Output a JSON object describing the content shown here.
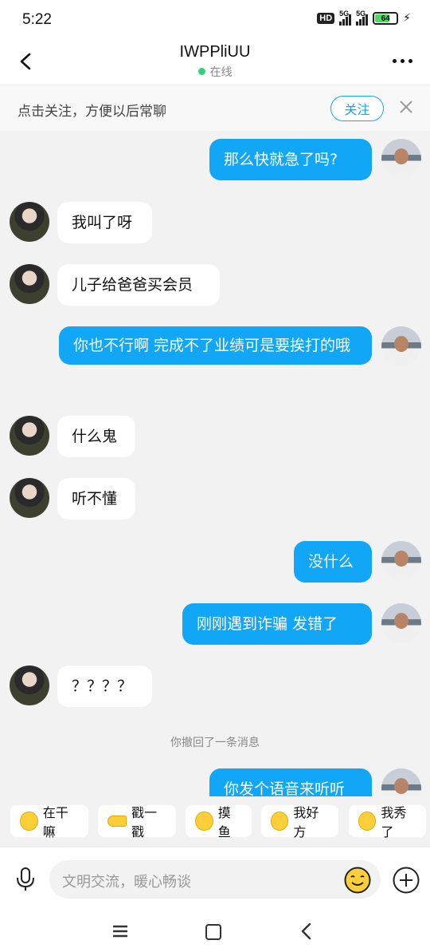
{
  "status_bar": {
    "time": "5:22",
    "hd_label": "HD",
    "network1": "5G",
    "network2": "5G",
    "battery_level": "64",
    "battery_color": "#4cd964"
  },
  "header": {
    "contact_name": "IWPPliUU",
    "presence": "在线",
    "presence_color": "#35d07f"
  },
  "follow_bar": {
    "text": "点击关注，方便以后常聊",
    "button_label": "关注",
    "accent": "#12a6f7"
  },
  "messages": [
    {
      "from": "me",
      "text": "那么快就急了吗?"
    },
    {
      "from": "them",
      "text": "我叫了呀"
    },
    {
      "from": "them",
      "text": "儿子给爸爸买会员"
    },
    {
      "from": "me",
      "text": "你也不行啊  完成不了业绩可是要挨打的哦"
    },
    {
      "from": "them",
      "text": "什么鬼"
    },
    {
      "from": "them",
      "text": "听不懂"
    },
    {
      "from": "me",
      "text": "没什么"
    },
    {
      "from": "me",
      "text": "刚刚遇到诈骗  发错了"
    },
    {
      "from": "them",
      "text": "？？？？"
    },
    {
      "from": "system",
      "text": "你撤回了一条消息"
    },
    {
      "from": "me",
      "text": "你发个语音来听听"
    }
  ],
  "quick_replies": [
    {
      "label": "在干嘛",
      "icon": "emoji-icon"
    },
    {
      "label": "戳一戳",
      "icon": "poke-hand-icon"
    },
    {
      "label": "摸鱼",
      "icon": "emoji-icon"
    },
    {
      "label": "我好方",
      "icon": "emoji-icon"
    },
    {
      "label": "我秀了",
      "icon": "emoji-icon"
    }
  ],
  "input_bar": {
    "placeholder": "文明交流，暖心畅谈"
  }
}
